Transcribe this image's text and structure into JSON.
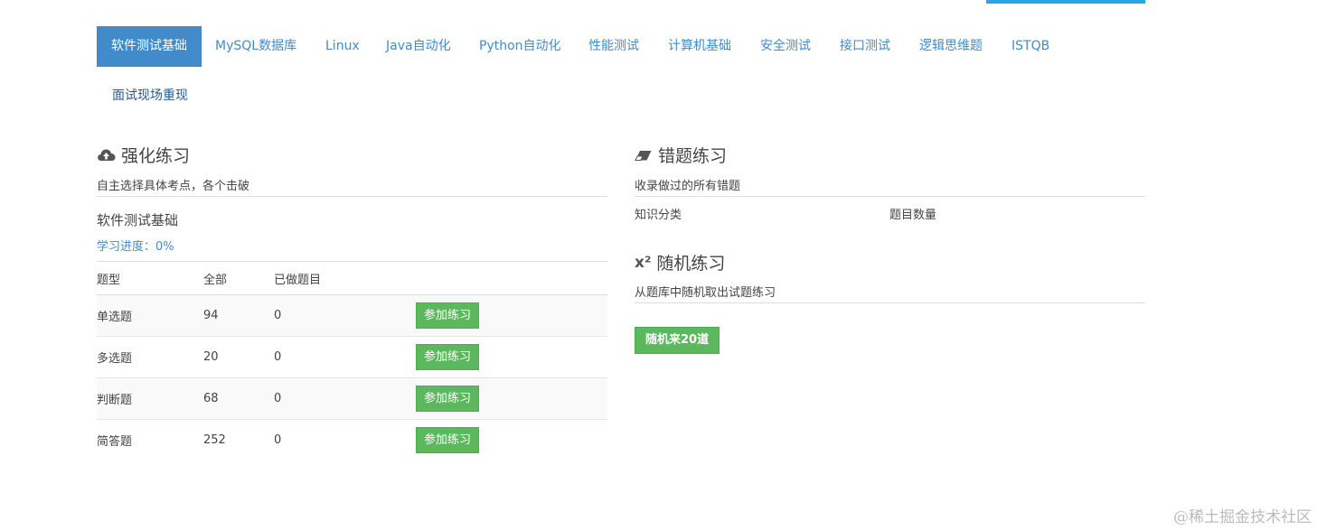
{
  "tabs": [
    {
      "label": "软件测试基础",
      "active": true
    },
    {
      "label": "MySQL数据库"
    },
    {
      "label": "Linux"
    },
    {
      "label": "Java自动化"
    },
    {
      "label": "Python自动化"
    },
    {
      "label": "性能测试"
    },
    {
      "label": "计算机基础"
    },
    {
      "label": "安全测试"
    },
    {
      "label": "接口测试"
    },
    {
      "label": "逻辑思维题"
    },
    {
      "label": "ISTQB"
    },
    {
      "label": "面试现场重现"
    }
  ],
  "practice": {
    "title": "强化练习",
    "icon": "cloud-upload-icon",
    "description": "自主选择具体考点，各个击破",
    "subject": "软件测试基础",
    "progress_label": "学习进度：",
    "progress_value": "0%",
    "headers": {
      "type": "题型",
      "all": "全部",
      "done": "已做题目"
    },
    "rows": [
      {
        "type": "单选题",
        "all": "94",
        "done": "0",
        "action": "参加练习"
      },
      {
        "type": "多选题",
        "all": "20",
        "done": "0",
        "action": "参加练习"
      },
      {
        "type": "判断题",
        "all": "68",
        "done": "0",
        "action": "参加练习"
      },
      {
        "type": "简答题",
        "all": "252",
        "done": "0",
        "action": "参加练习"
      }
    ]
  },
  "wrong": {
    "title": "错题练习",
    "icon": "eraser-icon",
    "description": "收录做过的所有错题",
    "col_category": "知识分类",
    "col_count": "题目数量"
  },
  "random": {
    "title": "随机练习",
    "icon_text": "x²",
    "description": "从题库中随机取出试题练习",
    "button": "随机来20道"
  },
  "watermark": "@稀土掘金技术社区",
  "colors": {
    "primary": "#428bca",
    "success": "#5cb85c",
    "accent": "#2aa5e4"
  }
}
